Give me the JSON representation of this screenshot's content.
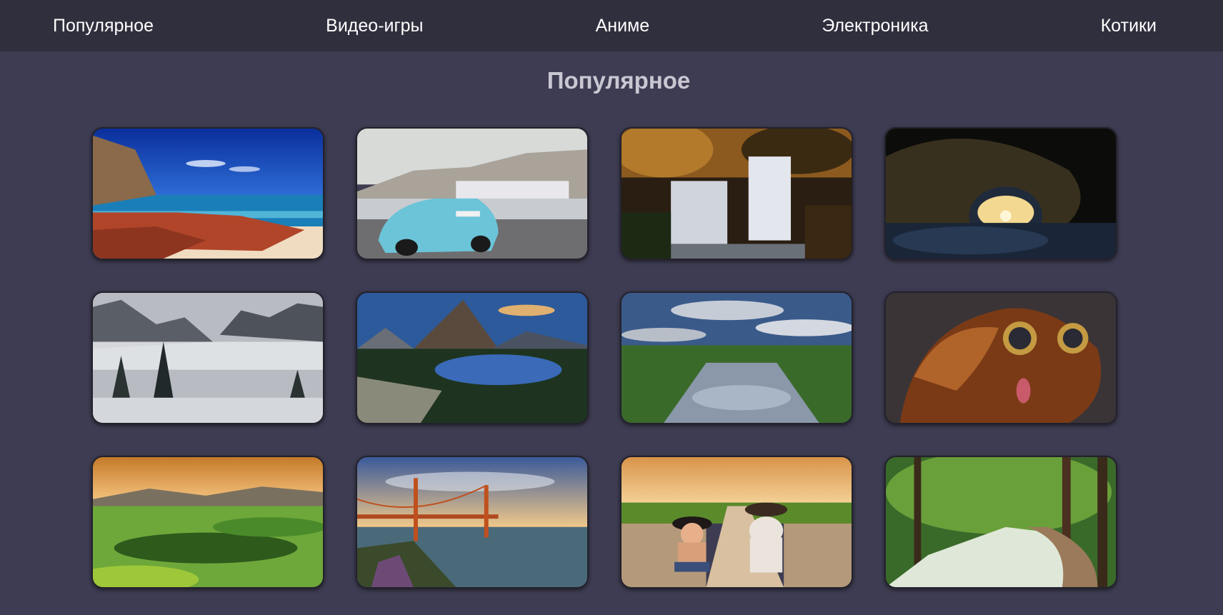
{
  "nav": {
    "items": [
      {
        "label": "Популярное"
      },
      {
        "label": "Видео-игры"
      },
      {
        "label": "Аниме"
      },
      {
        "label": "Электроника"
      },
      {
        "label": "Котики"
      }
    ]
  },
  "main": {
    "title": "Популярное"
  },
  "gallery": {
    "images": [
      {
        "subject": "beach-with-red-rocks"
      },
      {
        "subject": "blue-sports-car-marina"
      },
      {
        "subject": "forest-waterfall"
      },
      {
        "subject": "surfer-in-wave-tunnel"
      },
      {
        "subject": "snowy-misty-mountains"
      },
      {
        "subject": "mountain-lake"
      },
      {
        "subject": "river-under-cloudy-sky"
      },
      {
        "subject": "dog-in-sunglasses"
      },
      {
        "subject": "green-hills-sunset"
      },
      {
        "subject": "golden-gate-bridge"
      },
      {
        "subject": "baby-and-bulldog-in-cowboy-hats"
      },
      {
        "subject": "forest-path"
      }
    ]
  },
  "colors": {
    "background": "#3e3c52",
    "nav_background": "#302f3d",
    "nav_text": "#ffffff",
    "title_text": "#c9c8d2"
  }
}
